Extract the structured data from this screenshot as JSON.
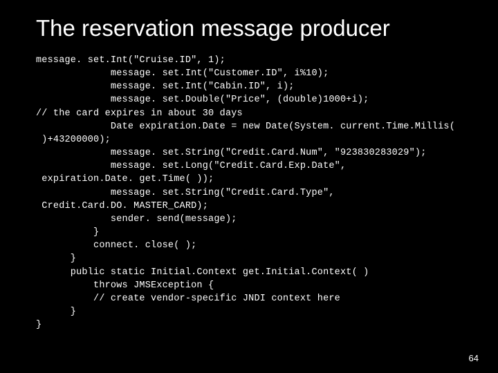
{
  "title": "The reservation message producer",
  "code_lines": [
    "message. set.Int(\"Cruise.ID\", 1);",
    "             message. set.Int(\"Customer.ID\", i%10);",
    "             message. set.Int(\"Cabin.ID\", i);",
    "             message. set.Double(\"Price\", (double)1000+i);",
    "// the card expires in about 30 days",
    "             Date expiration.Date = new Date(System. current.Time.Millis(",
    " )+43200000);",
    "             message. set.String(\"Credit.Card.Num\", \"923830283029\");",
    "             message. set.Long(\"Credit.Card.Exp.Date\",",
    " expiration.Date. get.Time( ));",
    "             message. set.String(\"Credit.Card.Type\",",
    " Credit.Card.DO. MASTER_CARD);",
    "             sender. send(message);",
    "          }",
    "          connect. close( );",
    "      }",
    "      public static Initial.Context get.Initial.Context( )",
    "          throws JMSException {",
    "          // create vendor-specific JNDI context here",
    "      }",
    "}"
  ],
  "page_number": "64"
}
